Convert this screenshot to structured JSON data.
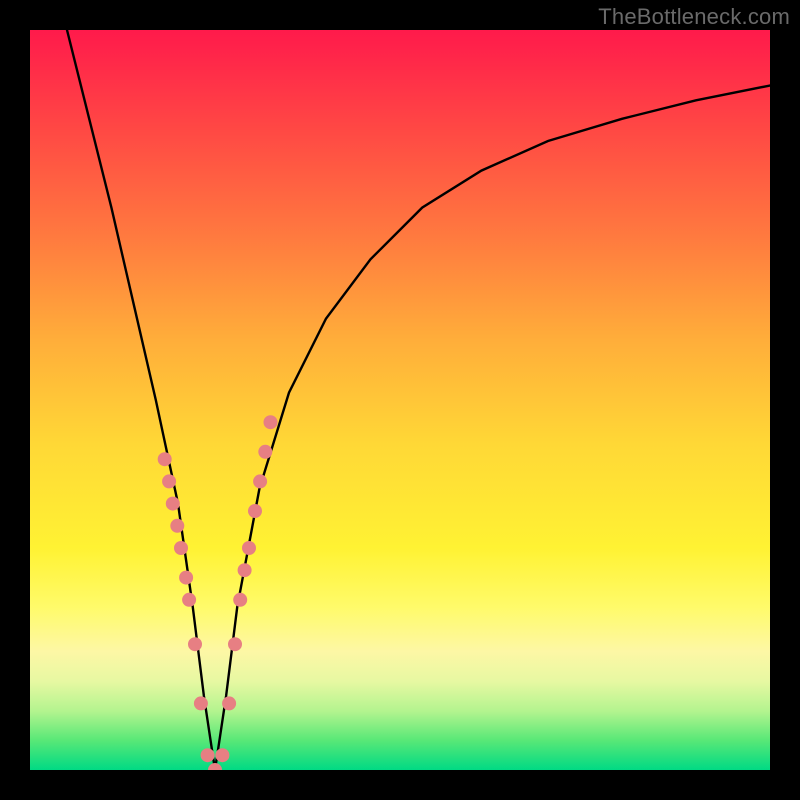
{
  "watermark": "TheBottleneck.com",
  "colors": {
    "frame": "#000000",
    "gradient_top": "#ff1a4b",
    "gradient_bottom": "#00da84",
    "curve": "#000000",
    "dots": "#e77f83"
  },
  "chart_data": {
    "type": "line",
    "title": "",
    "xlabel": "",
    "ylabel": "",
    "xlim": [
      0,
      100
    ],
    "ylim": [
      0,
      100
    ],
    "notch_x": 25,
    "series": [
      {
        "name": "bottleneck-curve",
        "x": [
          5,
          8,
          11,
          14,
          17,
          20,
          22,
          23.5,
          25,
          26.5,
          28,
          31,
          35,
          40,
          46,
          53,
          61,
          70,
          80,
          90,
          100
        ],
        "values": [
          100,
          88,
          76,
          63,
          50,
          36,
          22,
          10,
          0,
          10,
          22,
          38,
          51,
          61,
          69,
          76,
          81,
          85,
          88,
          90.5,
          92.5
        ]
      }
    ],
    "highlighted_points": {
      "name": "sample-dots",
      "x": [
        18.2,
        18.8,
        19.3,
        19.9,
        20.4,
        21.1,
        21.5,
        22.3,
        23.1,
        24.0,
        25.0,
        26.0,
        26.9,
        27.7,
        28.4,
        29.0,
        29.6,
        30.4,
        31.1,
        31.8,
        32.5
      ],
      "values": [
        42,
        39,
        36,
        33,
        30,
        26,
        23,
        17,
        9,
        2,
        0,
        2,
        9,
        17,
        23,
        27,
        30,
        35,
        39,
        43,
        47
      ]
    }
  }
}
